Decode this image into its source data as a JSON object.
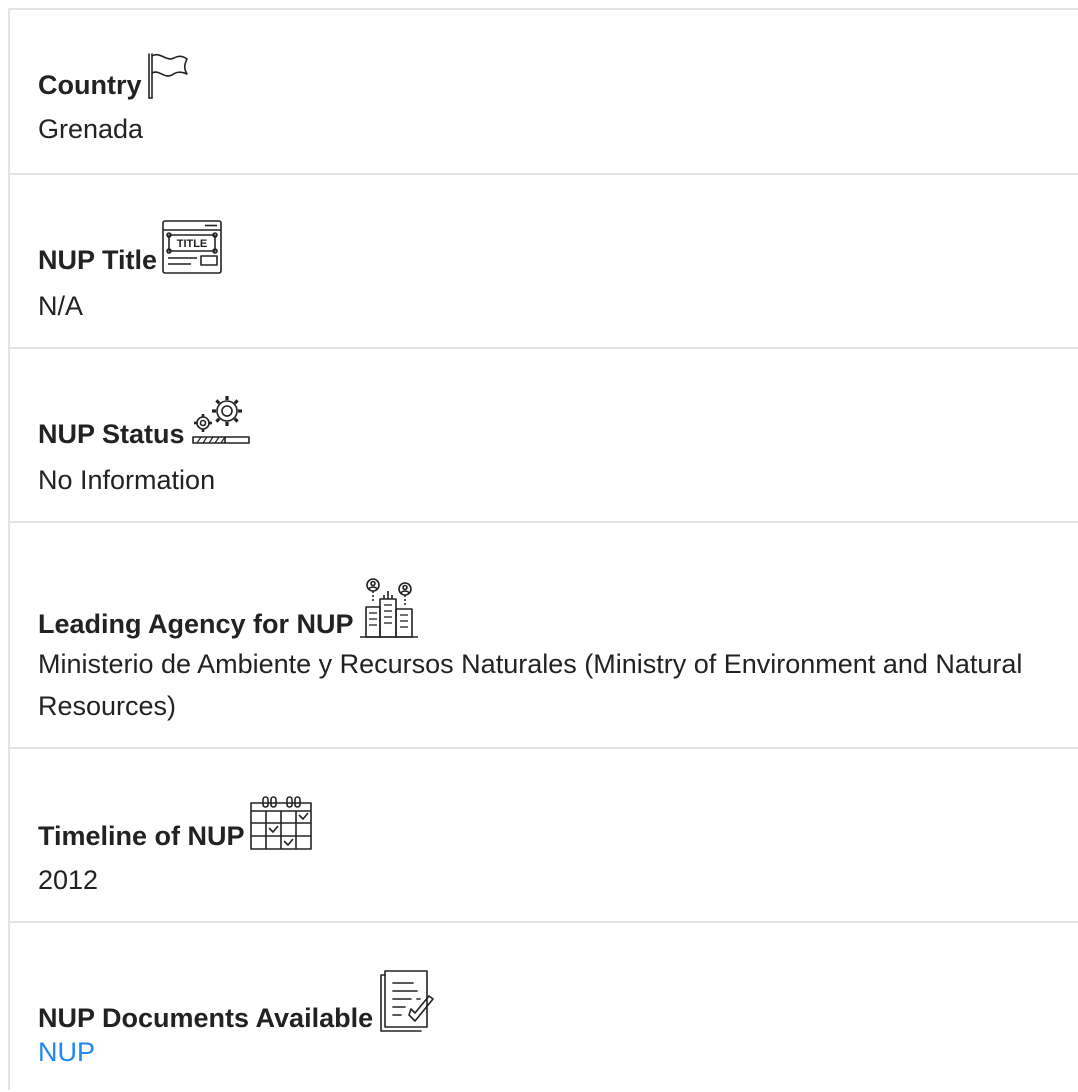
{
  "fields": [
    {
      "label": "Country",
      "icon": "flag-icon",
      "value": "Grenada"
    },
    {
      "label": "NUP Title",
      "icon": "title-window-icon",
      "value": "N/A"
    },
    {
      "label": "NUP Status",
      "icon": "gears-progress-icon",
      "value": "No Information"
    },
    {
      "label": "Leading Agency for NUP",
      "icon": "agency-buildings-icon",
      "value": "Ministerio de Ambiente y Recursos Naturales (Ministry of Environment and Natural Resources)"
    },
    {
      "label": "Timeline of NUP",
      "icon": "calendar-check-icon",
      "value": "2012"
    },
    {
      "label": "NUP Documents Available",
      "icon": "document-check-icon",
      "value": "NUP"
    }
  ],
  "colors": {
    "link": "#1e87f0",
    "border": "#e3e3e3",
    "text": "#222222"
  }
}
